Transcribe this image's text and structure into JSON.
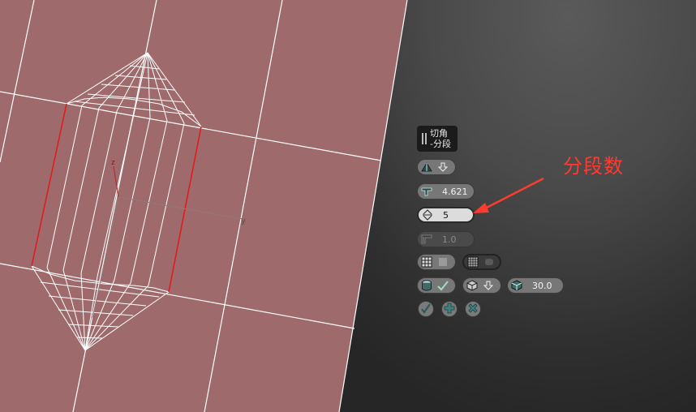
{
  "caddy": {
    "title_line1": "切角",
    "title_line2": "-分段",
    "amount_value": "4.621",
    "segments_value": "5",
    "tension_value": "1.0",
    "angle_value": "30.0"
  },
  "annotation": {
    "label": "分段数",
    "color": "#ff3b30"
  },
  "viewport": {
    "axis_labels": {
      "z": "z",
      "y": "y"
    },
    "mesh_color": "#9e6a6c"
  },
  "icons": [
    "grip-icon",
    "chamfer-type-icon",
    "dropdown-arrow-icon",
    "amount-icon",
    "segments-spinner-icon",
    "tension-icon",
    "quad-chamfer-icon",
    "mesh-grid-icon",
    "smooth-icon",
    "cylinder-icon",
    "check-icon",
    "cube-icon",
    "angle-icon",
    "ok-icon",
    "apply-icon",
    "cancel-icon"
  ]
}
